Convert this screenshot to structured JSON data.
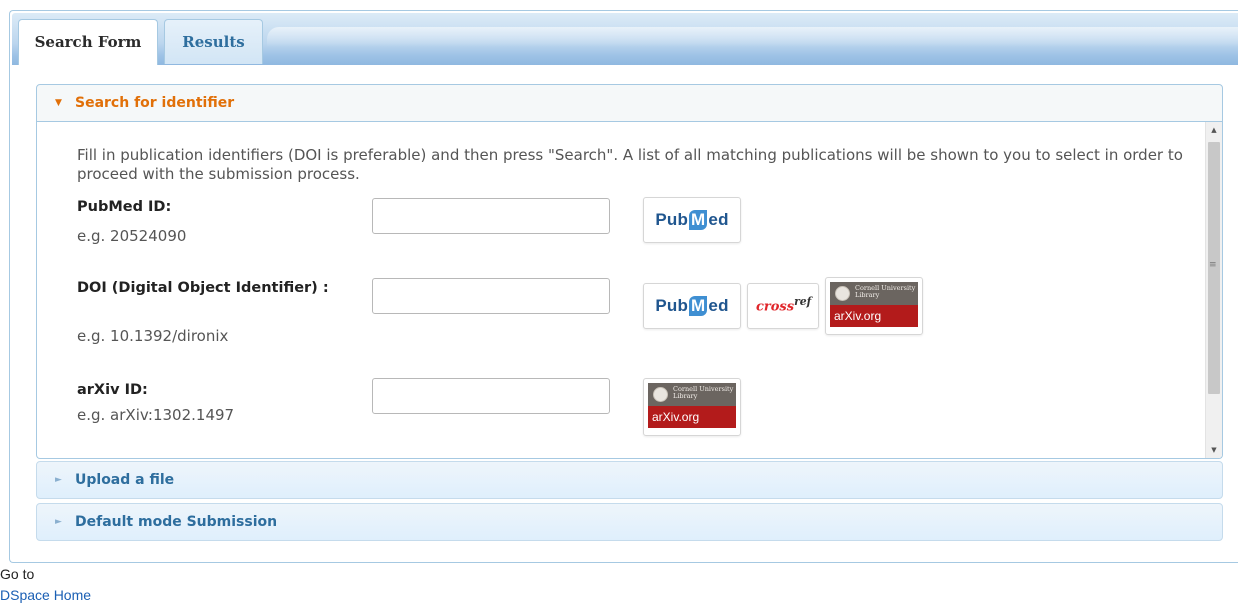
{
  "tabs": [
    {
      "label": "Search Form",
      "active": true
    },
    {
      "label": "Results",
      "active": false
    }
  ],
  "accordion": {
    "search_section": {
      "title": "Search for identifier",
      "expanded": true
    },
    "upload_section": {
      "title": "Upload a file",
      "expanded": false
    },
    "default_section": {
      "title": "Default mode Submission",
      "expanded": false
    }
  },
  "search": {
    "intro": "Fill in publication identifiers (DOI is preferable) and then press \"Search\". A list of all matching publications will be shown to you to select in order to proceed with the submission process.",
    "fields": [
      {
        "label": "PubMed ID:",
        "example": "e.g. 20524090",
        "value": "",
        "providers": [
          "PubMed"
        ]
      },
      {
        "label": "DOI (Digital Object Identifier) :",
        "example": "e.g. 10.1392/dironix",
        "value": "",
        "providers": [
          "PubMed",
          "crossref",
          "arXiv.org"
        ]
      },
      {
        "label": "arXiv ID:",
        "example": "e.g. arXiv:1302.1497",
        "value": "",
        "providers": [
          "arXiv.org"
        ]
      }
    ]
  },
  "logos": {
    "pubmed_pub": "Pub",
    "pubmed_m": "M",
    "pubmed_ed": "ed",
    "crossref_cross": "cross",
    "crossref_ref": "ref",
    "arxiv_institution_line1": "Cornell University",
    "arxiv_institution_line2": "Library",
    "arxiv_name": "arXiv.org"
  },
  "footer": {
    "goto_label": "Go to",
    "home_link": "DSpace Home"
  },
  "colors": {
    "tab_bar": "#8fb8e0",
    "active_header_text": "#e17009",
    "header_text": "#2e6e9e",
    "arxiv_red": "#b31b1b",
    "pubmed_blue": "#20568f"
  }
}
